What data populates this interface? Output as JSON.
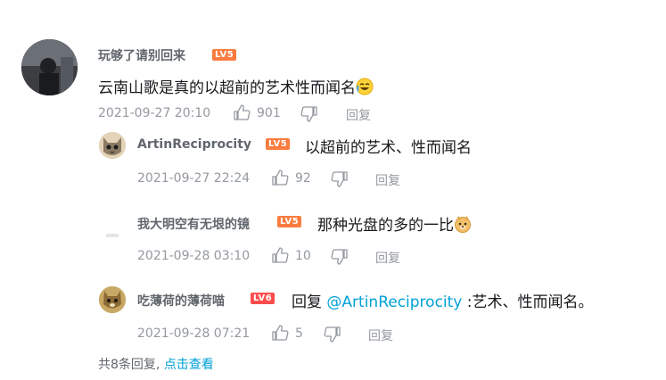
{
  "comments": [
    {
      "username": "玩够了请别回来",
      "level": "LV5",
      "text": "云南山歌是真的以超前的艺术性而闻名",
      "emoji": "laughing-crying-emoji",
      "time": "2021-09-27 20:10",
      "likes": "901",
      "reply_label": "回复"
    },
    {
      "username": "ArtinReciprocity",
      "level": "LV5",
      "text": "以超前的艺术、性而闻名",
      "time": "2021-09-27 22:24",
      "likes": "92",
      "reply_label": "回复"
    },
    {
      "username": "我大明空有无垠的镜",
      "level": "LV5",
      "text": "那种光盘的多的一比",
      "emoji": "doge-emoji",
      "time": "2021-09-28 03:10",
      "likes": "10",
      "reply_label": "回复"
    },
    {
      "username": "吃薄荷的薄荷喵",
      "level": "LV6",
      "reply_prefix": "回复",
      "mention": "@ArtinReciprocity",
      "text": ":艺术、性而闻名。",
      "time": "2021-09-28 07:21",
      "likes": "5",
      "reply_label": "回复"
    }
  ],
  "footer": {
    "total": "共8条回复,",
    "view_link": "点击查看"
  },
  "colors": {
    "link": "#00a1d6",
    "muted": "#9499a0",
    "level5": "#fb7c3f",
    "level6": "#ff4d4d"
  }
}
